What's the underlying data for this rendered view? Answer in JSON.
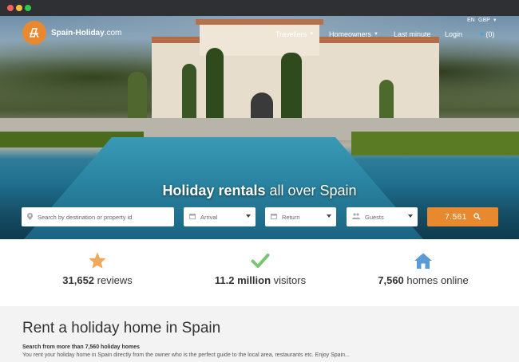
{
  "brand": {
    "name": "Spain-Holiday",
    "tld": ".com"
  },
  "nav": {
    "items": [
      {
        "label": "Travellers",
        "dropdown": true
      },
      {
        "label": "Homeowners",
        "dropdown": true
      },
      {
        "label": "Last minute",
        "dropdown": false
      },
      {
        "label": "Login",
        "dropdown": false
      }
    ],
    "favorites_count": "(0)",
    "language": "EN",
    "currency": "GBP"
  },
  "hero": {
    "headline_bold": "Holiday rentals",
    "headline_rest": " all over Spain"
  },
  "search": {
    "destination_placeholder": "Search by destination or property id",
    "arrival_label": "Arrival",
    "return_label": "Return",
    "guests_label": "Guests",
    "button_label": "7.561"
  },
  "stats": [
    {
      "icon": "star-icon",
      "value": "31,652",
      "label": " reviews",
      "color": "#f0a85a"
    },
    {
      "icon": "check-icon",
      "value": "11.2 million",
      "label": " visitors",
      "color": "#7cc576"
    },
    {
      "icon": "home-icon",
      "value": "7,560",
      "label": " homes online",
      "color": "#5b9bd5"
    }
  ],
  "intro": {
    "title": "Rent a holiday home in Spain",
    "subtitle": "Search from more than 7,560 holiday homes",
    "body": "You rent your holiday home in Spain directly from the owner who is the perfect guide to the local area, restaurants etc. Enjoy Spain..."
  },
  "colors": {
    "accent": "#e8892f",
    "heart": "#4aa3df"
  }
}
